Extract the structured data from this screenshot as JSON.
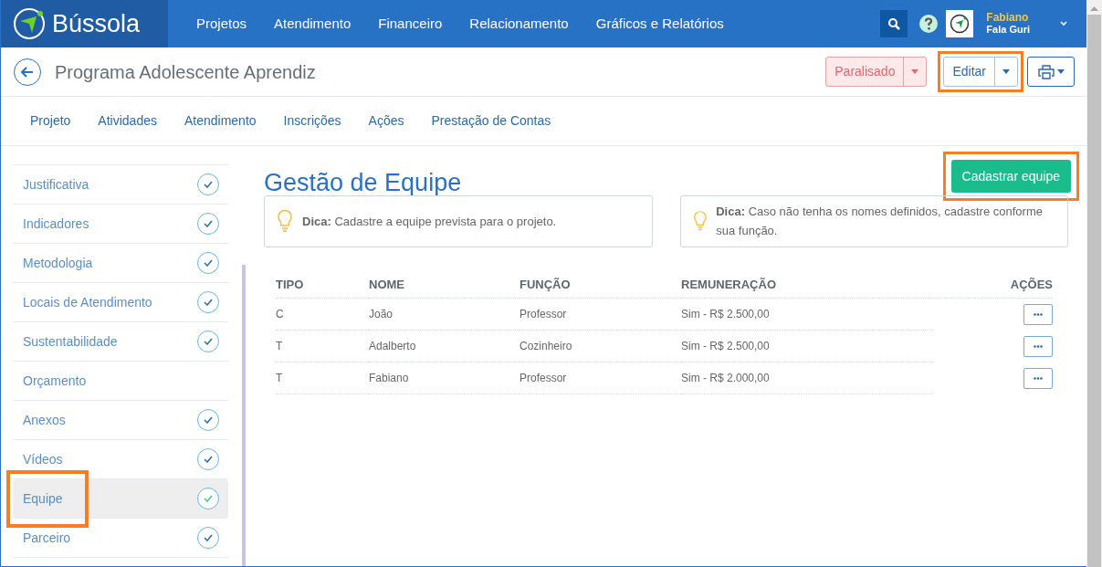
{
  "app": {
    "name": "Bússola"
  },
  "nav": [
    "Projetos",
    "Atendimento",
    "Financeiro",
    "Relacionamento",
    "Gráficos e Relatórios"
  ],
  "user": {
    "name": "Fabiano",
    "org": "Fala Guri"
  },
  "page": {
    "title": "Programa Adolescente Aprendiz"
  },
  "status_button": {
    "label": "Paralisado"
  },
  "edit_button": {
    "label": "Editar",
    "highlighted": true
  },
  "tabs": [
    {
      "label": "Projeto",
      "selected": false
    },
    {
      "label": "Atividades",
      "selected": false
    },
    {
      "label": "Atendimento",
      "selected": false
    },
    {
      "label": "Inscrições",
      "selected": false
    },
    {
      "label": "Ações",
      "selected": false
    },
    {
      "label": "Prestação de Contas",
      "selected": false
    }
  ],
  "sidebar": {
    "items": [
      {
        "label": "Justificativa",
        "checked": true,
        "selected": false,
        "highlighted": false
      },
      {
        "label": "Indicadores",
        "checked": true,
        "selected": false,
        "highlighted": false
      },
      {
        "label": "Metodologia",
        "checked": true,
        "selected": false,
        "highlighted": false
      },
      {
        "label": "Locais de Atendimento",
        "checked": true,
        "selected": false,
        "highlighted": false
      },
      {
        "label": "Sustentabilidade",
        "checked": true,
        "selected": false,
        "highlighted": false
      },
      {
        "label": "Orçamento",
        "checked": false,
        "selected": false,
        "highlighted": false
      },
      {
        "label": "Anexos",
        "checked": true,
        "selected": false,
        "highlighted": false
      },
      {
        "label": "Vídeos",
        "checked": true,
        "selected": false,
        "highlighted": false
      },
      {
        "label": "Equipe",
        "checked": true,
        "selected": true,
        "highlighted": true
      },
      {
        "label": "Parceiro",
        "checked": true,
        "selected": false,
        "highlighted": false
      }
    ]
  },
  "content": {
    "title": "Gestão de Equipe",
    "add_button": {
      "label": "Cadastrar equipe",
      "highlighted": true
    },
    "tips": [
      "**Dica:** Cadastre a equipe prevista para o projeto.",
      "**Dica:** Caso não tenha os nomes definidos, cadastre conforme sua função."
    ],
    "table": {
      "columns": [
        "TIPO",
        "NOME",
        "FUNÇÃO",
        "REMUNERAÇÃO",
        "AÇÕES"
      ],
      "rows": [
        [
          "C",
          "João",
          "Professor",
          "Sim - R$ 2.500,00"
        ],
        [
          "T",
          "Adalberto",
          "Cozinheiro",
          "Sim - R$ 2.500,00"
        ],
        [
          "T",
          "Fabiano",
          "Professor",
          "Sim - R$ 2.000,00"
        ]
      ]
    }
  }
}
